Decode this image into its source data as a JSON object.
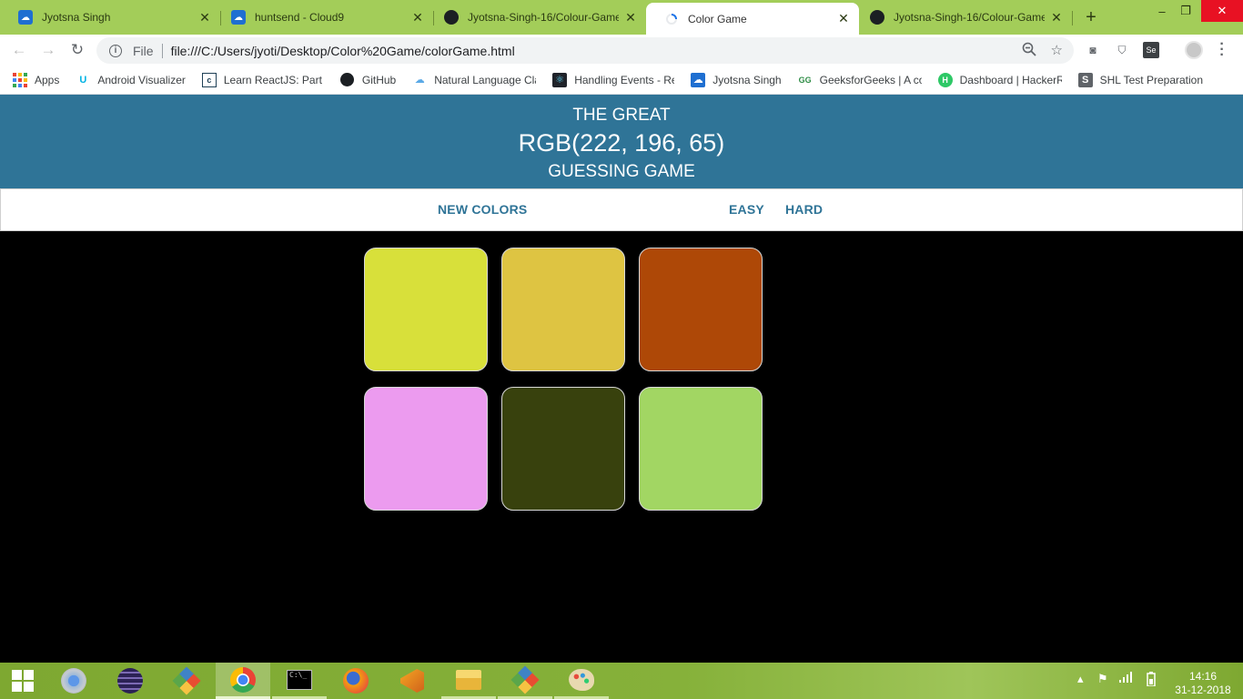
{
  "browser": {
    "tabs": [
      {
        "title": "Jyotsna Singh",
        "favicon": "cloud9-icon",
        "active": false
      },
      {
        "title": "huntsend - Cloud9",
        "favicon": "cloud9-icon",
        "active": false
      },
      {
        "title": "Jyotsna-Singh-16/Colour-Game",
        "favicon": "github-icon",
        "active": false
      },
      {
        "title": "Color Game",
        "favicon": "loading-spinner-icon",
        "active": true
      },
      {
        "title": "Jyotsna-Singh-16/Colour-Game",
        "favicon": "github-icon",
        "active": false
      }
    ],
    "new_tab": "+",
    "window_controls": {
      "minimize": "–",
      "restore": "❐",
      "close": "✕"
    },
    "address": {
      "scheme_label": "File",
      "url": "file:///C:/Users/jyoti/Desktop/Color%20Game/colorGame.html"
    },
    "bookmarks": [
      {
        "label": "Apps",
        "icon": "apps-grid-icon"
      },
      {
        "label": "Android Visualizer",
        "icon": "udacity-icon"
      },
      {
        "label": "Learn ReactJS: Part I |",
        "icon": "codecademy-icon"
      },
      {
        "label": "GitHub",
        "icon": "github-icon"
      },
      {
        "label": "Natural Language Cla",
        "icon": "cloud-icon"
      },
      {
        "label": "Handling Events - Re",
        "icon": "react-icon"
      },
      {
        "label": "Jyotsna Singh",
        "icon": "cloud9-icon"
      },
      {
        "label": "GeeksforGeeks | A co",
        "icon": "geeksforgeeks-icon"
      },
      {
        "label": "Dashboard | HackerR",
        "icon": "hackerrank-icon"
      },
      {
        "label": "SHL Test Preparation",
        "icon": "shl-icon"
      }
    ]
  },
  "game": {
    "header": {
      "line1": "The Great",
      "rgb": "RGB(222, 196, 65)",
      "line3": "Guessing Game"
    },
    "controls": {
      "new_colors": "New Colors",
      "message": "",
      "easy": "Easy",
      "hard": "Hard"
    },
    "squares": [
      "#d8e03a",
      "#dec442",
      "#ae4807",
      "#ec9bef",
      "#38410d",
      "#a2d663"
    ]
  },
  "taskbar": {
    "apps": [
      "windows-start-icon",
      "chrome-canary-icon",
      "eclipse-icon",
      "git-gui-icon",
      "chrome-icon",
      "command-prompt-icon",
      "firefox-icon",
      "visual-studio-icon",
      "file-explorer-icon",
      "git-icon",
      "paint-icon"
    ],
    "time": "14:16",
    "date": "31-12-2018"
  },
  "colors": {
    "header_bg": "#2f7497",
    "accent": "#2f7497",
    "page_bg": "#000000",
    "chrome_frame": "#a3cd59"
  }
}
